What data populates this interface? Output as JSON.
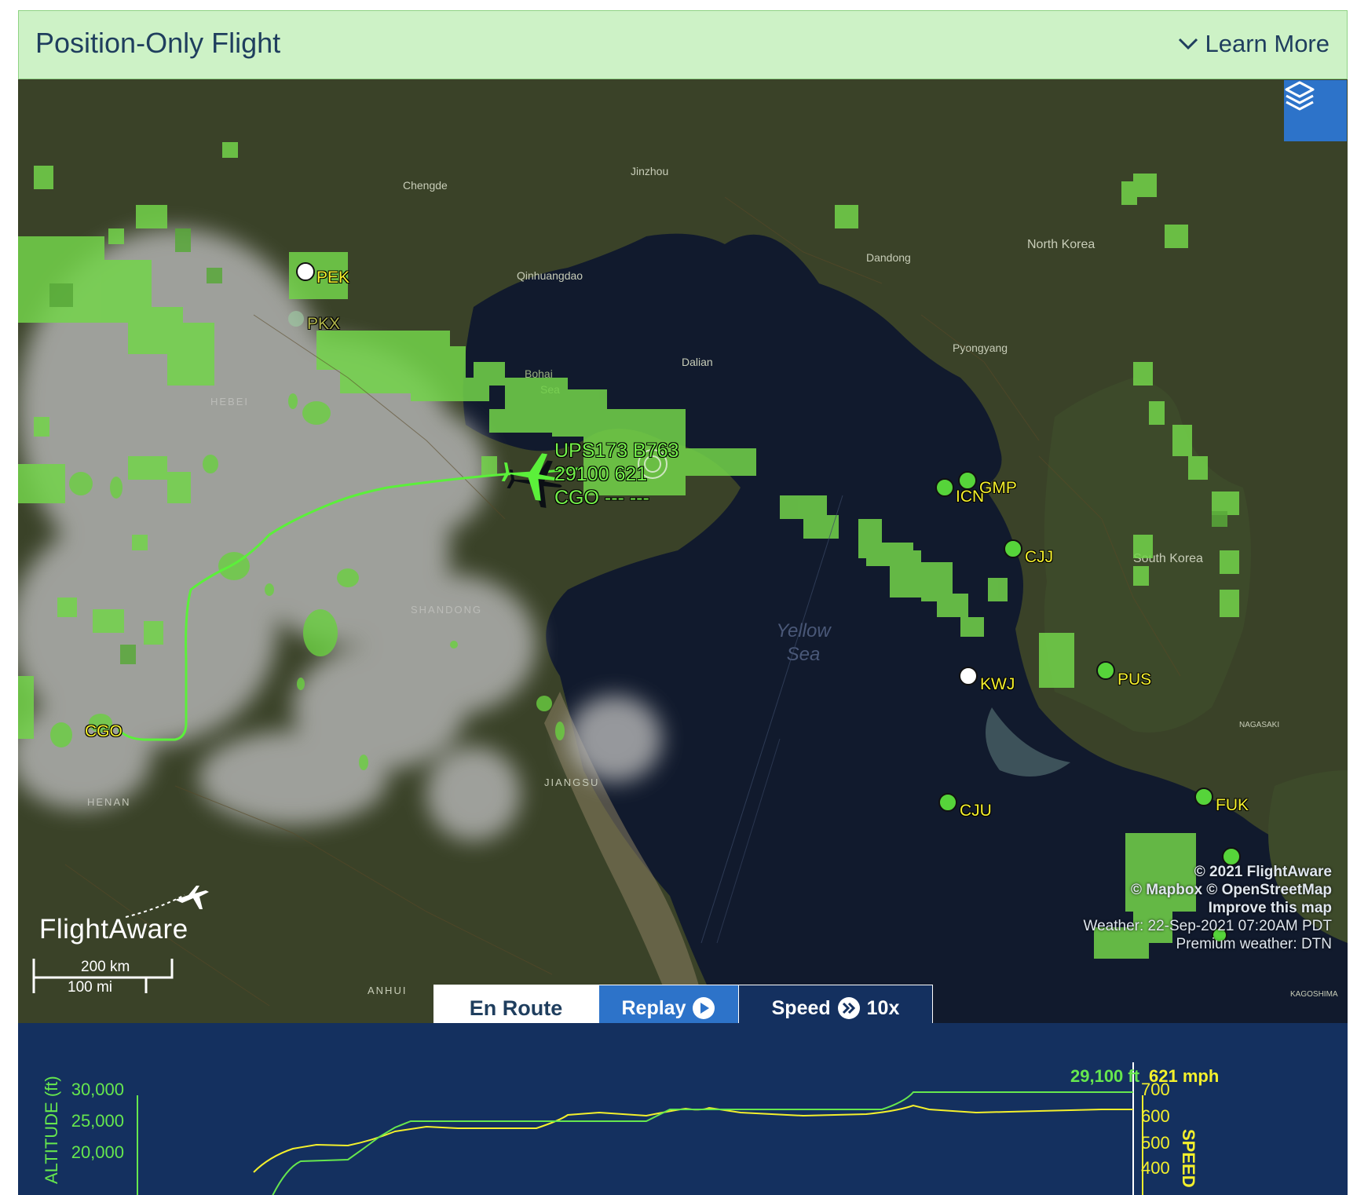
{
  "banner": {
    "title": "Position-Only Flight",
    "learn_more": "Learn More"
  },
  "colors": {
    "route": "#5bf03a",
    "weather": "#73d44a",
    "airport_dot": "#56d43a",
    "label": "#f4f02c",
    "accent": "#2d73c9",
    "graph_bg": "#14305f"
  },
  "map": {
    "layers_icon": "layers-icon",
    "flight": {
      "line1": "UPS173 B763",
      "line2": "29100 621",
      "line3": "CGO --- ---"
    },
    "airports": [
      "PEK",
      "PKX",
      "ICN",
      "GMP",
      "CJJ",
      "KWJ",
      "PUS",
      "CJU",
      "FUK",
      "CGO"
    ],
    "place_names": [
      "Chengde",
      "Jinzhou",
      "North Korea",
      "Dandong",
      "Qinhuangdao",
      "Bohai Sea",
      "Dalian",
      "Pyongyang",
      "Yellow",
      "Sea",
      "HEBEI",
      "SHANDONG",
      "JIANGSU",
      "HENAN",
      "ANHUI",
      "South Korea",
      "NAGASAKI",
      "KAGOSHIMA"
    ],
    "attribution": {
      "copyright": "© 2021 FlightAware",
      "osm": "© Mapbox © OpenStreetMap",
      "improve": "Improve this map",
      "weather": "Weather: 22-Sep-2021 07:20AM PDT",
      "premium": "Premium weather: DTN"
    },
    "logo": "FlightAware",
    "scale": {
      "km": "200 km",
      "mi": "100 mi"
    }
  },
  "tabs": {
    "en_route": "En Route",
    "replay": "Replay",
    "speed_label": "Speed",
    "speed_value": "10x"
  },
  "graph": {
    "altitude_readout": "29,100 ft",
    "speed_readout": "621 mph",
    "left_ticks": [
      "30,000",
      "25,000",
      "20,000"
    ],
    "right_ticks": [
      "700",
      "600",
      "500",
      "400"
    ],
    "left_axis_label": "ALTITUDE (ft)",
    "right_axis_label": "SPEED"
  }
}
